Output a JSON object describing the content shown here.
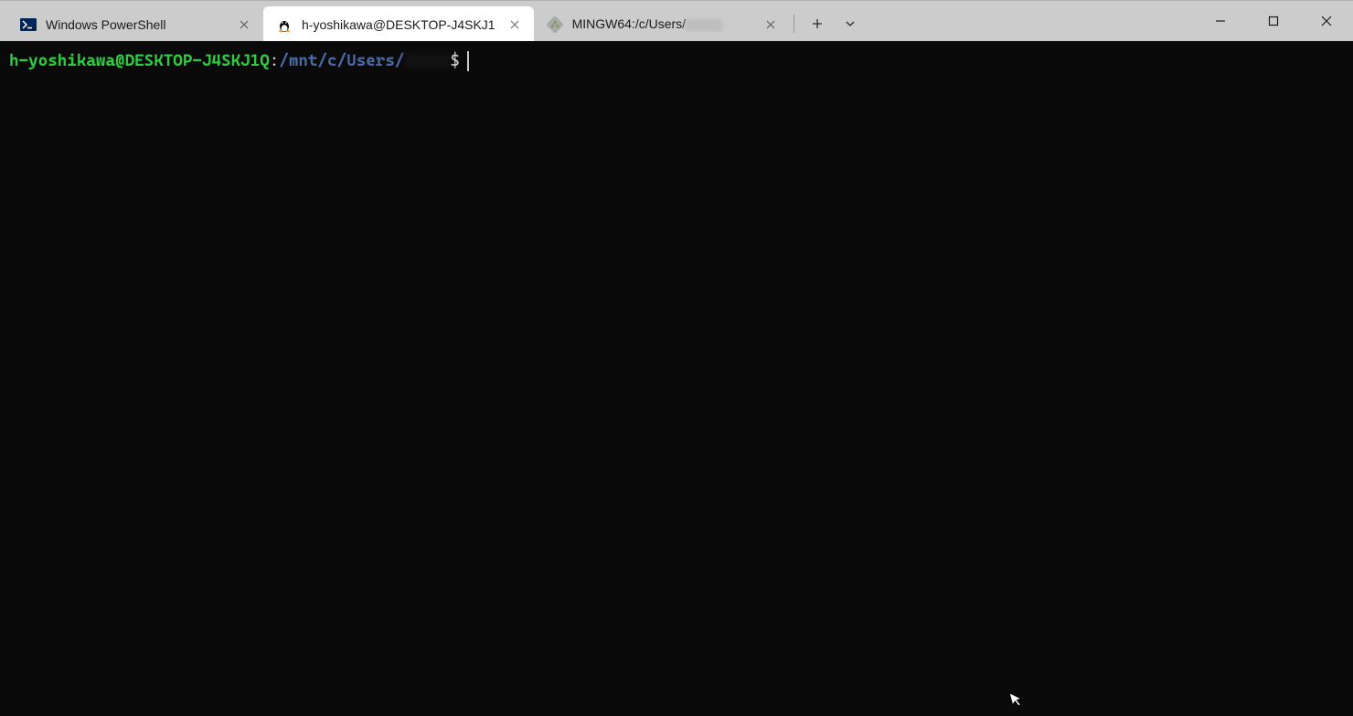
{
  "tabs": [
    {
      "label": "Windows PowerShell",
      "icon": "powershell-icon",
      "active": false
    },
    {
      "label": "h-yoshikawa@DESKTOP-J4SKJ1",
      "icon": "tux-icon",
      "active": true
    },
    {
      "label": "MINGW64:/c/Users/",
      "icon": "git-bash-icon",
      "active": false
    }
  ],
  "terminal": {
    "prompt_user": "h-yoshikawa@DESKTOP-J4SKJ1Q",
    "prompt_separator": ":",
    "prompt_path": "/mnt/c/Users/",
    "prompt_symbol": "$"
  },
  "colors": {
    "prompt_user": "#2ecc40",
    "prompt_path": "#4a6aa5",
    "terminal_bg": "#0a0a0a",
    "titlebar_bg": "#cccccc",
    "active_tab_bg": "#ffffff"
  }
}
